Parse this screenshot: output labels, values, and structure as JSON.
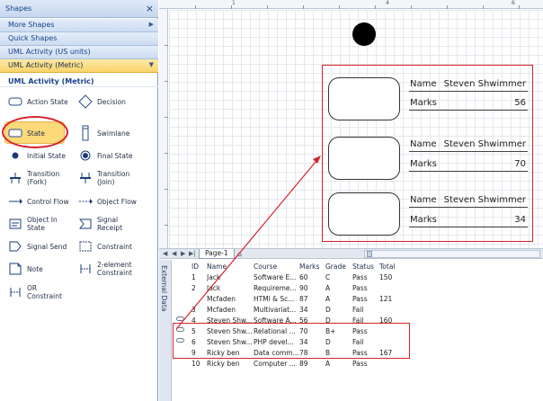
{
  "shapes_pane": {
    "title": "Shapes",
    "close_glyph": "×",
    "stencils": [
      {
        "label": "More Shapes",
        "arrow": "▶"
      },
      {
        "label": "Quick Shapes",
        "arrow": ""
      },
      {
        "label": "UML Activity (US units)",
        "arrow": ""
      },
      {
        "label": "UML Activity (Metric)",
        "arrow": "▼"
      }
    ],
    "header": "UML Activity (Metric)",
    "items": [
      {
        "label": "Action State",
        "icon": "action-state-icon"
      },
      {
        "label": "Decision",
        "icon": "decision-icon"
      },
      {
        "label": "State",
        "icon": "state-icon"
      },
      {
        "label": "Swimlane",
        "icon": "swimlane-icon"
      },
      {
        "label": "Initial State",
        "icon": "initial-state-icon"
      },
      {
        "label": "Final State",
        "icon": "final-state-icon"
      },
      {
        "label": "Transition (Fork)",
        "icon": "fork-icon"
      },
      {
        "label": "Transition (Join)",
        "icon": "join-icon"
      },
      {
        "label": "Control Flow",
        "icon": "control-flow-icon"
      },
      {
        "label": "Object Flow",
        "icon": "object-flow-icon"
      },
      {
        "label": "Object In State",
        "icon": "object-in-state-icon"
      },
      {
        "label": "Signal Receipt",
        "icon": "signal-receipt-icon"
      },
      {
        "label": "Signal Send",
        "icon": "signal-send-icon"
      },
      {
        "label": "Constraint",
        "icon": "constraint-icon"
      },
      {
        "label": "Note",
        "icon": "note-icon"
      },
      {
        "label": "2-element Constraint",
        "icon": "two-element-constraint-icon"
      },
      {
        "label": "OR Constraint",
        "icon": "or-constraint-icon"
      }
    ]
  },
  "canvas": {
    "ruler_marks": [
      "1",
      "4",
      "6"
    ],
    "cards": [
      {
        "name_label": "Name",
        "name_value": "Steven Shwimmer",
        "marks_label": "Marks",
        "marks_value": "56"
      },
      {
        "name_label": "Name",
        "name_value": "Steven Shwimmer",
        "marks_label": "Marks",
        "marks_value": "70"
      },
      {
        "name_label": "Name",
        "name_value": "Steven Shwimmer",
        "marks_label": "Marks",
        "marks_value": "34"
      }
    ]
  },
  "tabbar": {
    "nav": [
      "◀",
      "▶",
      "▶|"
    ],
    "page_tab": "Page-1"
  },
  "external_data": {
    "title": "External Data",
    "columns": [
      "ID",
      "Name",
      "Course",
      "Marks",
      "Grade",
      "Status",
      "Total"
    ],
    "rows": [
      {
        "id": "1",
        "name": "Jack",
        "course": "Software E...",
        "marks": "60",
        "grade": "C",
        "status": "Pass",
        "total": "150",
        "linked": false
      },
      {
        "id": "2",
        "name": "Jack",
        "course": "Requireme...",
        "marks": "90",
        "grade": "A",
        "status": "Pass",
        "total": "",
        "linked": false
      },
      {
        "id": "",
        "name": "Mcfaden",
        "course": "HTMl & Sc...",
        "marks": "87",
        "grade": "A",
        "status": "Pass",
        "total": "121",
        "linked": false
      },
      {
        "id": "3",
        "name": "Mcfaden",
        "course": "Multivariat...",
        "marks": "34",
        "grade": "D",
        "status": "Fail",
        "total": "",
        "linked": false
      },
      {
        "id": "4",
        "name": "Steven Shw...",
        "course": "Software A...",
        "marks": "56",
        "grade": "D",
        "status": "Fail",
        "total": "160",
        "linked": true
      },
      {
        "id": "5",
        "name": "Steven Shw...",
        "course": "Relational ...",
        "marks": "70",
        "grade": "B+",
        "status": "Pass",
        "total": "",
        "linked": true
      },
      {
        "id": "6",
        "name": "Steven Shw...",
        "course": "PHP devel...",
        "marks": "34",
        "grade": "D",
        "status": "Fail",
        "total": "",
        "linked": true
      },
      {
        "id": "9",
        "name": "Ricky ben",
        "course": "Data comm...",
        "marks": "78",
        "grade": "B",
        "status": "Pass",
        "total": "167",
        "linked": false
      },
      {
        "id": "10",
        "name": "Ricky ben",
        "course": "Computer ...",
        "marks": "89",
        "grade": "A",
        "status": "Pass",
        "total": "",
        "linked": false
      }
    ]
  },
  "colors": {
    "highlight_red": "#d4232b",
    "active_stencil": "#f9d36b",
    "ribbon_blue": "#15428b"
  }
}
